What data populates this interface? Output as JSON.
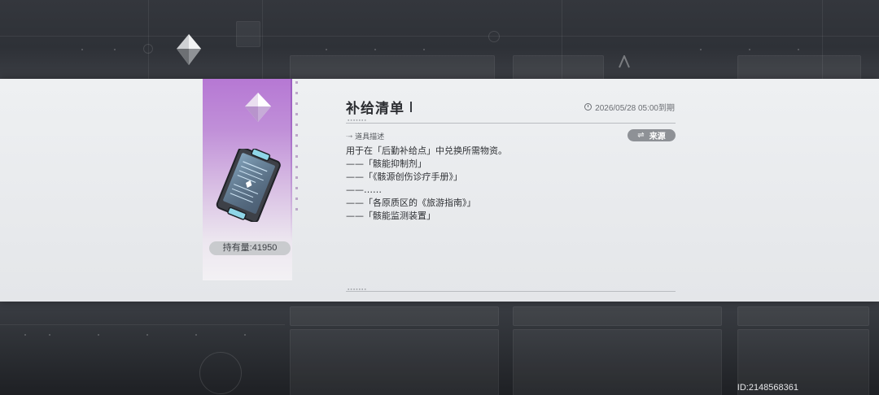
{
  "item": {
    "title": "补给清单",
    "expire": "2026/05/28 05:00到期",
    "count": "持有量:41950",
    "section_label": "道具描述",
    "source_button": "来源",
    "description": [
      "用于在「后勤补给点」中兑换所需物资。",
      "——「骸能抑制剂」",
      "——「《骸源创伤诊疗手册》」",
      "——……",
      "——「各原质区的《旅游指南》」",
      "——「骸能监测装置」"
    ]
  },
  "footer": {
    "id": "ID:2148568361"
  },
  "colors": {
    "card_top": "#b678d4",
    "band": "#eef0f2",
    "button": "#8e9196"
  },
  "icons": [
    "gem-icon",
    "supply-list-item-icon",
    "clock-icon",
    "swap-icon"
  ]
}
